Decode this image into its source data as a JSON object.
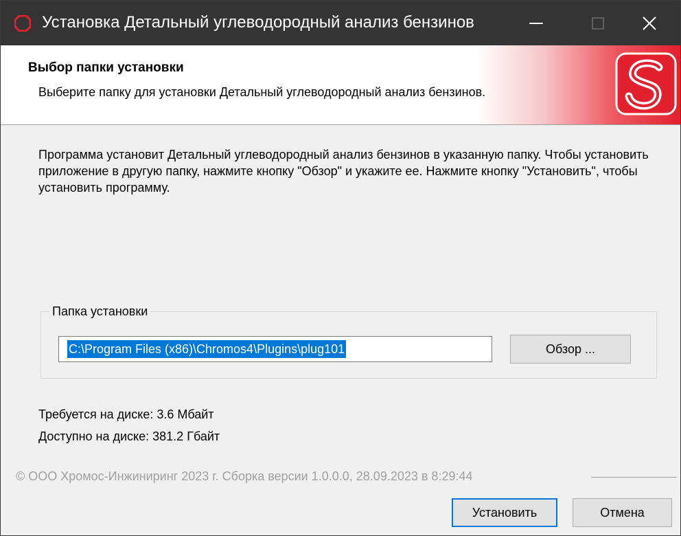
{
  "window": {
    "title": "Установка Детальный углеводородный анализ бензинов",
    "controls": {
      "minimize": "minimize-icon",
      "maximize": "maximize-icon",
      "close": "close-icon"
    }
  },
  "header": {
    "title": "Выбор папки установки",
    "subtitle": "Выберите папку для установки Детальный углеводородный анализ бензинов."
  },
  "body": {
    "description": "Программа установит Детальный углеводородный анализ бензинов в указанную папку. Чтобы установить приложение в другую папку, нажмите кнопку \"Обзор\" и укажите ее. Нажмите кнопку \"Установить\", чтобы установить программу.",
    "install_folder": {
      "legend": "Папка установки",
      "path": "C:\\Program Files (x86)\\Chromos4\\Plugins\\plug101",
      "browse_label": "Обзор ..."
    },
    "space_required": "Требуется на диске: 3.6 Мбайт",
    "space_available": "Доступно на диске: 381.2 Гбайт"
  },
  "footer": {
    "branding": "© ООО Хромос-Инжиниринг 2023 г. Сборка версии 1.0.0.0, 28.09.2023 в 8:29:44",
    "install_label": "Установить",
    "cancel_label": "Отмена"
  },
  "colors": {
    "titlebar": "#343434",
    "accent_red": "#e2202e",
    "selection": "#0078d7",
    "dialog_bg": "#f0f0f0"
  }
}
